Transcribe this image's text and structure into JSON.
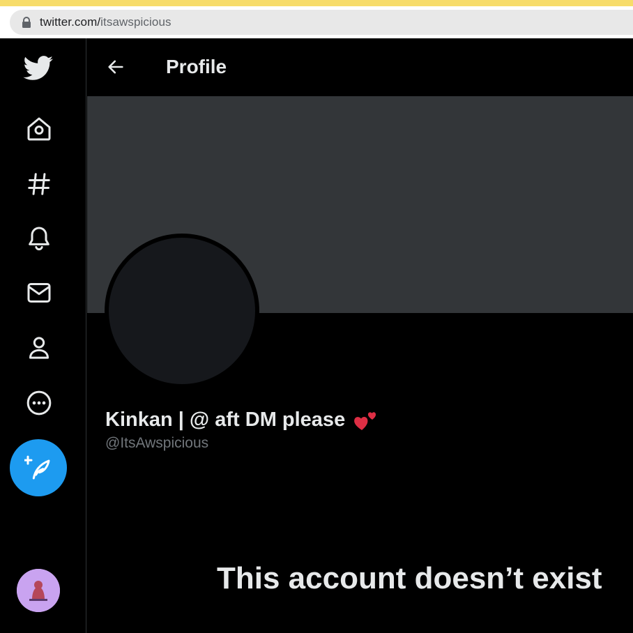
{
  "browser": {
    "url_host": "twitter.com/",
    "url_path": "itsawspicious",
    "lock_icon": "lock-icon",
    "tab_strip_color": "#f7dc6a"
  },
  "sidebar": {
    "items": [
      {
        "id": "logo",
        "icon": "twitter-bird-icon"
      },
      {
        "id": "home",
        "icon": "home-icon"
      },
      {
        "id": "explore",
        "icon": "hashtag-icon"
      },
      {
        "id": "notifications",
        "icon": "bell-icon"
      },
      {
        "id": "messages",
        "icon": "envelope-icon"
      },
      {
        "id": "profile",
        "icon": "person-icon"
      },
      {
        "id": "more",
        "icon": "more-circle-icon"
      }
    ],
    "tweet_button": {
      "icon": "compose-feather-icon",
      "color": "#1d9bf0"
    },
    "account_avatar": {
      "color": "#c9a3f0"
    }
  },
  "header": {
    "title": "Profile",
    "back_icon": "arrow-left-icon"
  },
  "profile": {
    "display_name": "Kinkan | @ aft DM please",
    "name_emoji": "two-hearts-icon",
    "handle": "@ItsAwspicious",
    "banner_color": "#333639"
  },
  "empty_state": {
    "title": "This account doesn’t exist"
  },
  "colors": {
    "background": "#000000",
    "text_primary": "#e7e9ea",
    "text_secondary": "#71767b",
    "accent": "#1d9bf0"
  }
}
